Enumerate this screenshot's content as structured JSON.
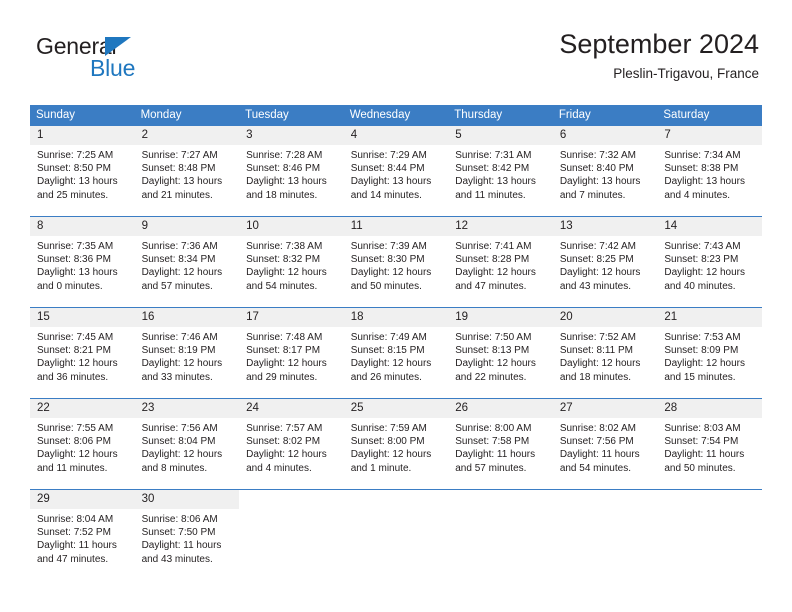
{
  "brand": {
    "name_top": "General",
    "name_bottom": "Blue",
    "accent_color": "#1f77bf"
  },
  "header": {
    "title": "September 2024",
    "subtitle": "Pleslin-Trigavou, France"
  },
  "theme": {
    "header_blue": "#3b7dc4",
    "daynum_gray": "#f0f0f0",
    "text": "#231f20"
  },
  "weekday_headers": [
    "Sunday",
    "Monday",
    "Tuesday",
    "Wednesday",
    "Thursday",
    "Friday",
    "Saturday"
  ],
  "weeks": [
    [
      {
        "day": "1",
        "sunrise": "Sunrise: 7:25 AM",
        "sunset": "Sunset: 8:50 PM",
        "daylight1": "Daylight: 13 hours",
        "daylight2": "and 25 minutes."
      },
      {
        "day": "2",
        "sunrise": "Sunrise: 7:27 AM",
        "sunset": "Sunset: 8:48 PM",
        "daylight1": "Daylight: 13 hours",
        "daylight2": "and 21 minutes."
      },
      {
        "day": "3",
        "sunrise": "Sunrise: 7:28 AM",
        "sunset": "Sunset: 8:46 PM",
        "daylight1": "Daylight: 13 hours",
        "daylight2": "and 18 minutes."
      },
      {
        "day": "4",
        "sunrise": "Sunrise: 7:29 AM",
        "sunset": "Sunset: 8:44 PM",
        "daylight1": "Daylight: 13 hours",
        "daylight2": "and 14 minutes."
      },
      {
        "day": "5",
        "sunrise": "Sunrise: 7:31 AM",
        "sunset": "Sunset: 8:42 PM",
        "daylight1": "Daylight: 13 hours",
        "daylight2": "and 11 minutes."
      },
      {
        "day": "6",
        "sunrise": "Sunrise: 7:32 AM",
        "sunset": "Sunset: 8:40 PM",
        "daylight1": "Daylight: 13 hours",
        "daylight2": "and 7 minutes."
      },
      {
        "day": "7",
        "sunrise": "Sunrise: 7:34 AM",
        "sunset": "Sunset: 8:38 PM",
        "daylight1": "Daylight: 13 hours",
        "daylight2": "and 4 minutes."
      }
    ],
    [
      {
        "day": "8",
        "sunrise": "Sunrise: 7:35 AM",
        "sunset": "Sunset: 8:36 PM",
        "daylight1": "Daylight: 13 hours",
        "daylight2": "and 0 minutes."
      },
      {
        "day": "9",
        "sunrise": "Sunrise: 7:36 AM",
        "sunset": "Sunset: 8:34 PM",
        "daylight1": "Daylight: 12 hours",
        "daylight2": "and 57 minutes."
      },
      {
        "day": "10",
        "sunrise": "Sunrise: 7:38 AM",
        "sunset": "Sunset: 8:32 PM",
        "daylight1": "Daylight: 12 hours",
        "daylight2": "and 54 minutes."
      },
      {
        "day": "11",
        "sunrise": "Sunrise: 7:39 AM",
        "sunset": "Sunset: 8:30 PM",
        "daylight1": "Daylight: 12 hours",
        "daylight2": "and 50 minutes."
      },
      {
        "day": "12",
        "sunrise": "Sunrise: 7:41 AM",
        "sunset": "Sunset: 8:28 PM",
        "daylight1": "Daylight: 12 hours",
        "daylight2": "and 47 minutes."
      },
      {
        "day": "13",
        "sunrise": "Sunrise: 7:42 AM",
        "sunset": "Sunset: 8:25 PM",
        "daylight1": "Daylight: 12 hours",
        "daylight2": "and 43 minutes."
      },
      {
        "day": "14",
        "sunrise": "Sunrise: 7:43 AM",
        "sunset": "Sunset: 8:23 PM",
        "daylight1": "Daylight: 12 hours",
        "daylight2": "and 40 minutes."
      }
    ],
    [
      {
        "day": "15",
        "sunrise": "Sunrise: 7:45 AM",
        "sunset": "Sunset: 8:21 PM",
        "daylight1": "Daylight: 12 hours",
        "daylight2": "and 36 minutes."
      },
      {
        "day": "16",
        "sunrise": "Sunrise: 7:46 AM",
        "sunset": "Sunset: 8:19 PM",
        "daylight1": "Daylight: 12 hours",
        "daylight2": "and 33 minutes."
      },
      {
        "day": "17",
        "sunrise": "Sunrise: 7:48 AM",
        "sunset": "Sunset: 8:17 PM",
        "daylight1": "Daylight: 12 hours",
        "daylight2": "and 29 minutes."
      },
      {
        "day": "18",
        "sunrise": "Sunrise: 7:49 AM",
        "sunset": "Sunset: 8:15 PM",
        "daylight1": "Daylight: 12 hours",
        "daylight2": "and 26 minutes."
      },
      {
        "day": "19",
        "sunrise": "Sunrise: 7:50 AM",
        "sunset": "Sunset: 8:13 PM",
        "daylight1": "Daylight: 12 hours",
        "daylight2": "and 22 minutes."
      },
      {
        "day": "20",
        "sunrise": "Sunrise: 7:52 AM",
        "sunset": "Sunset: 8:11 PM",
        "daylight1": "Daylight: 12 hours",
        "daylight2": "and 18 minutes."
      },
      {
        "day": "21",
        "sunrise": "Sunrise: 7:53 AM",
        "sunset": "Sunset: 8:09 PM",
        "daylight1": "Daylight: 12 hours",
        "daylight2": "and 15 minutes."
      }
    ],
    [
      {
        "day": "22",
        "sunrise": "Sunrise: 7:55 AM",
        "sunset": "Sunset: 8:06 PM",
        "daylight1": "Daylight: 12 hours",
        "daylight2": "and 11 minutes."
      },
      {
        "day": "23",
        "sunrise": "Sunrise: 7:56 AM",
        "sunset": "Sunset: 8:04 PM",
        "daylight1": "Daylight: 12 hours",
        "daylight2": "and 8 minutes."
      },
      {
        "day": "24",
        "sunrise": "Sunrise: 7:57 AM",
        "sunset": "Sunset: 8:02 PM",
        "daylight1": "Daylight: 12 hours",
        "daylight2": "and 4 minutes."
      },
      {
        "day": "25",
        "sunrise": "Sunrise: 7:59 AM",
        "sunset": "Sunset: 8:00 PM",
        "daylight1": "Daylight: 12 hours",
        "daylight2": "and 1 minute."
      },
      {
        "day": "26",
        "sunrise": "Sunrise: 8:00 AM",
        "sunset": "Sunset: 7:58 PM",
        "daylight1": "Daylight: 11 hours",
        "daylight2": "and 57 minutes."
      },
      {
        "day": "27",
        "sunrise": "Sunrise: 8:02 AM",
        "sunset": "Sunset: 7:56 PM",
        "daylight1": "Daylight: 11 hours",
        "daylight2": "and 54 minutes."
      },
      {
        "day": "28",
        "sunrise": "Sunrise: 8:03 AM",
        "sunset": "Sunset: 7:54 PM",
        "daylight1": "Daylight: 11 hours",
        "daylight2": "and 50 minutes."
      }
    ],
    [
      {
        "day": "29",
        "sunrise": "Sunrise: 8:04 AM",
        "sunset": "Sunset: 7:52 PM",
        "daylight1": "Daylight: 11 hours",
        "daylight2": "and 47 minutes."
      },
      {
        "day": "30",
        "sunrise": "Sunrise: 8:06 AM",
        "sunset": "Sunset: 7:50 PM",
        "daylight1": "Daylight: 11 hours",
        "daylight2": "and 43 minutes."
      },
      {
        "day": "",
        "sunrise": "",
        "sunset": "",
        "daylight1": "",
        "daylight2": ""
      },
      {
        "day": "",
        "sunrise": "",
        "sunset": "",
        "daylight1": "",
        "daylight2": ""
      },
      {
        "day": "",
        "sunrise": "",
        "sunset": "",
        "daylight1": "",
        "daylight2": ""
      },
      {
        "day": "",
        "sunrise": "",
        "sunset": "",
        "daylight1": "",
        "daylight2": ""
      },
      {
        "day": "",
        "sunrise": "",
        "sunset": "",
        "daylight1": "",
        "daylight2": ""
      }
    ]
  ]
}
